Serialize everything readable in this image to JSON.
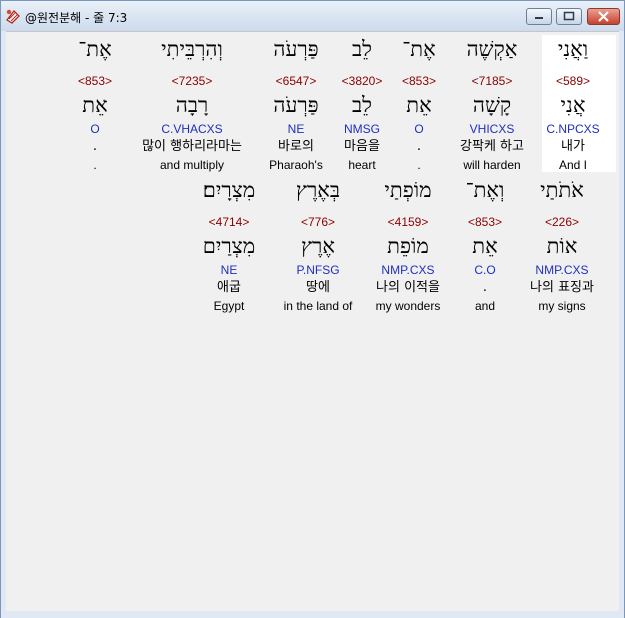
{
  "window": {
    "title": "@원전분해 - 줄 7:3",
    "icon": "interlinear-app-icon",
    "buttons": [
      "minimize-icon",
      "maximize-icon",
      "close-icon"
    ]
  },
  "lines": [
    {
      "words": [
        {
          "hebrew": "וַאֲנִי",
          "strong": "<589>",
          "lemma": "אֲנִי",
          "parse": "C.NPCXS",
          "korean": "내가",
          "english": "And I",
          "highlight": true
        },
        {
          "hebrew": "אַקְשֶׁה",
          "strong": "<7185>",
          "lemma": "קָשָׁה",
          "parse": "VHICXS",
          "korean": "강팍케 하고",
          "english": "will harden"
        },
        {
          "hebrew": "אֶת־",
          "strong": "<853>",
          "lemma": "אֵת",
          "parse": "O",
          "korean": ".",
          "english": "."
        },
        {
          "hebrew": "לֵב",
          "strong": "<3820>",
          "lemma": "לֵב",
          "parse": "NMSG",
          "korean": "마음을",
          "english": "heart"
        },
        {
          "hebrew": "פַּרְעֹה",
          "strong": "<6547>",
          "lemma": "פַּרְעֹה",
          "parse": "NE",
          "korean": "바로의",
          "english": "Pharaoh's"
        },
        {
          "hebrew": "וְהִרְבֵּיתִי",
          "strong": "<7235>",
          "lemma": "רָבָה",
          "parse": "C.VHACXS",
          "korean": "많이 행하리라마는",
          "english": "and multiply"
        },
        {
          "hebrew": "אֶת־",
          "strong": "<853>",
          "lemma": "אֵת",
          "parse": "O",
          "korean": ".",
          "english": "."
        }
      ]
    },
    {
      "words": [
        {
          "hebrew": "אֹתֹתַי",
          "strong": "<226>",
          "lemma": "אוֹת",
          "parse": "NMP.CXS",
          "korean": "나의 표징과",
          "english": "my signs"
        },
        {
          "hebrew": "וְאֶת־",
          "strong": "<853>",
          "lemma": "אֵת",
          "parse": "C.O",
          "korean": ".",
          "english": "and"
        },
        {
          "hebrew": "מוֹפְתַי",
          "strong": "<4159>",
          "lemma": "מוֹפֵת",
          "parse": "NMP.CXS",
          "korean": "나의 이적을",
          "english": "my wonders"
        },
        {
          "hebrew": "בְּאֶרֶץ",
          "strong": "<776>",
          "lemma": "אֶרֶץ",
          "parse": "P.NFSG",
          "korean": "땅에",
          "english": "in the land of"
        },
        {
          "hebrew": "מִצְרָיִם׃",
          "strong": "<4714>",
          "lemma": "מִצְרַיִם",
          "parse": "NE",
          "korean": "애굽",
          "english": "Egypt"
        }
      ]
    }
  ]
}
